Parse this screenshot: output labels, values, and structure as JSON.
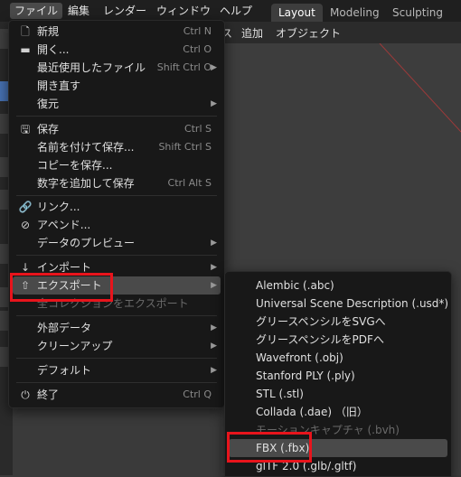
{
  "menubar": {
    "items": [
      "ファイル",
      "編集",
      "レンダー",
      "ウィンドウ",
      "ヘルプ"
    ]
  },
  "workspaces": {
    "tabs": [
      "Layout",
      "Modeling",
      "Sculpting"
    ]
  },
  "viewport_header": {
    "fragment": "ス",
    "add": "追加",
    "object": "オブジェクト"
  },
  "file_menu": {
    "new": {
      "label": "新規",
      "shortcut": "Ctrl N"
    },
    "open": {
      "label": "開く...",
      "shortcut": "Ctrl O"
    },
    "open_recent": {
      "label": "最近使用したファイル",
      "shortcut": "Shift Ctrl O"
    },
    "revert": {
      "label": "開き直す"
    },
    "recover": {
      "label": "復元"
    },
    "save": {
      "label": "保存",
      "shortcut": "Ctrl S"
    },
    "save_as": {
      "label": "名前を付けて保存...",
      "shortcut": "Shift Ctrl S"
    },
    "save_copy": {
      "label": "コピーを保存..."
    },
    "save_incremental": {
      "label": "数字を追加して保存",
      "shortcut": "Ctrl Alt S"
    },
    "link": {
      "label": "リンク..."
    },
    "append": {
      "label": "アペンド..."
    },
    "data_previews": {
      "label": "データのプレビュー"
    },
    "import": {
      "label": "インポート"
    },
    "export": {
      "label": "エクスポート"
    },
    "export_all_collections": {
      "label": "全コレクションをエクスポート"
    },
    "external_data": {
      "label": "外部データ"
    },
    "clean_up": {
      "label": "クリーンアップ"
    },
    "defaults": {
      "label": "デフォルト"
    },
    "quit": {
      "label": "終了",
      "shortcut": "Ctrl Q"
    }
  },
  "export_menu": {
    "items": [
      "Alembic (.abc)",
      "Universal Scene Description (.usd*)",
      "グリースペンシルをSVGへ",
      "グリースペンシルをPDFへ",
      "Wavefront (.obj)",
      "Stanford PLY (.ply)",
      "STL (.stl)",
      "Collada (.dae) （旧）",
      "モーションキャプチャ (.bvh)",
      "FBX (.fbx)",
      "glTF 2.0 (.glb/.gltf)"
    ]
  },
  "colors": {
    "highlight_box": "#e8141c",
    "menu_bg": "#181818",
    "hover_bg": "#4a4a4a",
    "active_tool": "#4772b3"
  }
}
